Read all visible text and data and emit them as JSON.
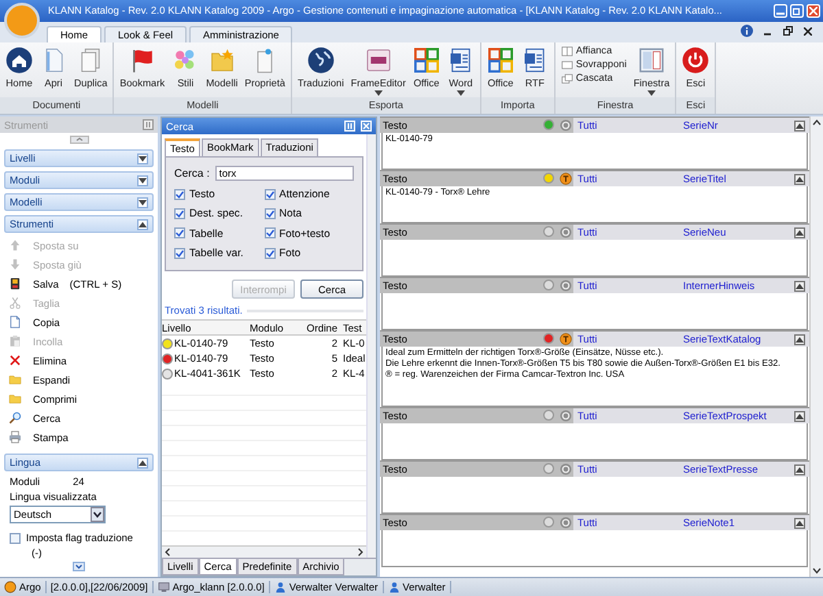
{
  "window": {
    "title": "KLANN Katalog - Rev. 2.0 KLANN Katalog 2009 - Argo - Gestione contenuti e impaginazione automatica - [KLANN Katalog - Rev. 2.0 KLANN Katalo..."
  },
  "ribbon_tabs": [
    {
      "label": "Home",
      "selected": true
    },
    {
      "label": "Look & Feel",
      "selected": false
    },
    {
      "label": "Amministrazione",
      "selected": false
    }
  ],
  "ribbon_groups": [
    {
      "label": "Documenti",
      "buttons": [
        {
          "label": "Home",
          "kind": "large",
          "dropdown": false
        },
        {
          "label": "Apri",
          "kind": "large",
          "dropdown": false
        },
        {
          "label": "Duplica",
          "kind": "large",
          "dropdown": false
        }
      ]
    },
    {
      "label": "Modelli",
      "buttons": [
        {
          "label": "Bookmark",
          "kind": "large",
          "dropdown": false
        },
        {
          "label": "Stili",
          "kind": "large",
          "dropdown": false
        },
        {
          "label": "Modelli",
          "kind": "large",
          "dropdown": false
        },
        {
          "label": "Proprietà",
          "kind": "large",
          "dropdown": false
        }
      ]
    },
    {
      "label": "Esporta",
      "buttons": [
        {
          "label": "Traduzioni",
          "kind": "large",
          "dropdown": false
        },
        {
          "label": "FrameEditor",
          "kind": "large",
          "dropdown": true
        },
        {
          "label": "Office",
          "kind": "large",
          "dropdown": false
        },
        {
          "label": "Word",
          "kind": "large",
          "dropdown": true
        }
      ]
    },
    {
      "label": "Importa",
      "buttons": [
        {
          "label": "Office",
          "kind": "large",
          "dropdown": false
        },
        {
          "label": "RTF",
          "kind": "large",
          "dropdown": false
        }
      ]
    },
    {
      "label": "Finestra",
      "buttons": [
        {
          "label": "Affianca",
          "kind": "small",
          "dropdown": false
        },
        {
          "label": "Sovrapponi",
          "kind": "small",
          "dropdown": false
        },
        {
          "label": "Cascata",
          "kind": "small",
          "dropdown": false
        },
        {
          "label": "Finestra",
          "kind": "large",
          "dropdown": true
        }
      ]
    },
    {
      "label": "Esci",
      "buttons": [
        {
          "label": "Esci",
          "kind": "large",
          "dropdown": false
        }
      ]
    }
  ],
  "sidebar": {
    "title": "Strumenti",
    "panels": [
      {
        "label": "Livelli",
        "expanded": false
      },
      {
        "label": "Moduli",
        "expanded": false
      },
      {
        "label": "Modelli",
        "expanded": false
      },
      {
        "label": "Strumenti",
        "expanded": true,
        "items": [
          {
            "label": "Sposta su",
            "disabled": true
          },
          {
            "label": "Sposta giù",
            "disabled": true
          },
          {
            "label": "Salva",
            "shortcut": "(CTRL + S)",
            "disabled": false
          },
          {
            "label": "Taglia",
            "disabled": true
          },
          {
            "label": "Copia",
            "disabled": false
          },
          {
            "label": "Incolla",
            "disabled": true
          },
          {
            "label": "Elimina",
            "disabled": false
          },
          {
            "label": "Espandi",
            "disabled": false
          },
          {
            "label": "Comprimi",
            "disabled": false
          },
          {
            "label": "Cerca",
            "disabled": false
          },
          {
            "label": "Stampa",
            "disabled": false
          }
        ]
      },
      {
        "label": "Lingua",
        "expanded": true,
        "language_block": {
          "modules_label": "Moduli",
          "modules_count": "24",
          "language_label": "Lingua visualizzata",
          "language": "Deutsch",
          "flag_option": {
            "label": "Imposta flag traduzione",
            "checked": false
          },
          "flag_value": "(-)"
        }
      }
    ]
  },
  "search_panel": {
    "title": "Cerca",
    "tabs": [
      {
        "label": "Testo",
        "selected": true
      },
      {
        "label": "BookMark",
        "selected": false
      },
      {
        "label": "Traduzioni",
        "selected": false
      }
    ],
    "query_label": "Cerca :",
    "query": "torx",
    "options": [
      {
        "label": "Testo",
        "checked": true
      },
      {
        "label": "Attenzione",
        "checked": true
      },
      {
        "label": "Dest. spec.",
        "checked": true
      },
      {
        "label": "Nota",
        "checked": true
      },
      {
        "label": "Tabelle",
        "checked": true
      },
      {
        "label": "Foto+testo",
        "checked": true
      },
      {
        "label": "Tabelle var.",
        "checked": true
      },
      {
        "label": "Foto",
        "checked": true
      }
    ],
    "buttons": [
      {
        "label": "Interrompi",
        "disabled": true
      },
      {
        "label": "Cerca",
        "disabled": false
      }
    ],
    "result_summary": "Trovati 3 risultati.",
    "columns": [
      "Livello",
      "Modulo",
      "Ordine",
      "Test"
    ],
    "rows": [
      {
        "color": "#f2e21a",
        "cells": [
          "KL-0140-79",
          "Testo",
          "2",
          "KL-0"
        ]
      },
      {
        "color": "#e02424",
        "cells": [
          "KL-0140-79",
          "Testo",
          "5",
          "Ideal"
        ]
      },
      {
        "color": "#e4e4e4",
        "cells": [
          "KL-4041-361K",
          "Testo",
          "2",
          "KL-4"
        ]
      }
    ],
    "bottom_tabs": [
      {
        "label": "Livelli",
        "selected": false
      },
      {
        "label": "Cerca",
        "selected": true
      },
      {
        "label": "Predefinite",
        "selected": false
      },
      {
        "label": "Archivio",
        "selected": false
      }
    ]
  },
  "editor": {
    "sections": [
      {
        "label": "Testo",
        "color": "#35b035",
        "flag": false,
        "scope": "Tutti",
        "field": "SerieNr",
        "lines": [
          "KL-0140-79"
        ]
      },
      {
        "label": "Testo",
        "color": "#f2d600",
        "flag": true,
        "scope": "Tutti",
        "field": "SerieTitel",
        "lines": [
          "KL-0140-79 - Torx® Lehre"
        ]
      },
      {
        "label": "Testo",
        "color": "#dcdcdc",
        "flag": false,
        "scope": "Tutti",
        "field": "SerieNeu"
      },
      {
        "label": "Testo",
        "color": "#dcdcdc",
        "flag": false,
        "scope": "Tutti",
        "field": "InternerHinweis"
      },
      {
        "label": "Testo",
        "color": "#e02424",
        "flag": true,
        "scope": "Tutti",
        "field": "SerieTextKatalog",
        "lines": [
          "Ideal zum Ermitteln der richtigen Torx®-Größe (Einsätze, Nüsse etc.).",
          "Die Lehre erkennt die Innen-Torx®-Größen T5 bis T80 sowie die Außen-Torx®-Größen E1 bis E32.",
          "® = reg. Warenzeichen der Firma Camcar-Textron Inc. USA"
        ]
      },
      {
        "label": "Testo",
        "color": "#dcdcdc",
        "flag": false,
        "scope": "Tutti",
        "field": "SerieTextProspekt"
      },
      {
        "label": "Testo",
        "color": "#dcdcdc",
        "flag": false,
        "scope": "Tutti",
        "field": "SerieTextPresse"
      },
      {
        "label": "Testo",
        "color": "#dcdcdc",
        "flag": false,
        "scope": "Tutti",
        "field": "SerieNote1"
      }
    ]
  },
  "status_bar": [
    {
      "text": "Argo"
    },
    {
      "text": "[2.0.0.0],[22/06/2009]"
    },
    {
      "text": "Argo_klann [2.0.0.0]"
    },
    {
      "text": "Verwalter Verwalter"
    },
    {
      "text": "Verwalter"
    }
  ]
}
